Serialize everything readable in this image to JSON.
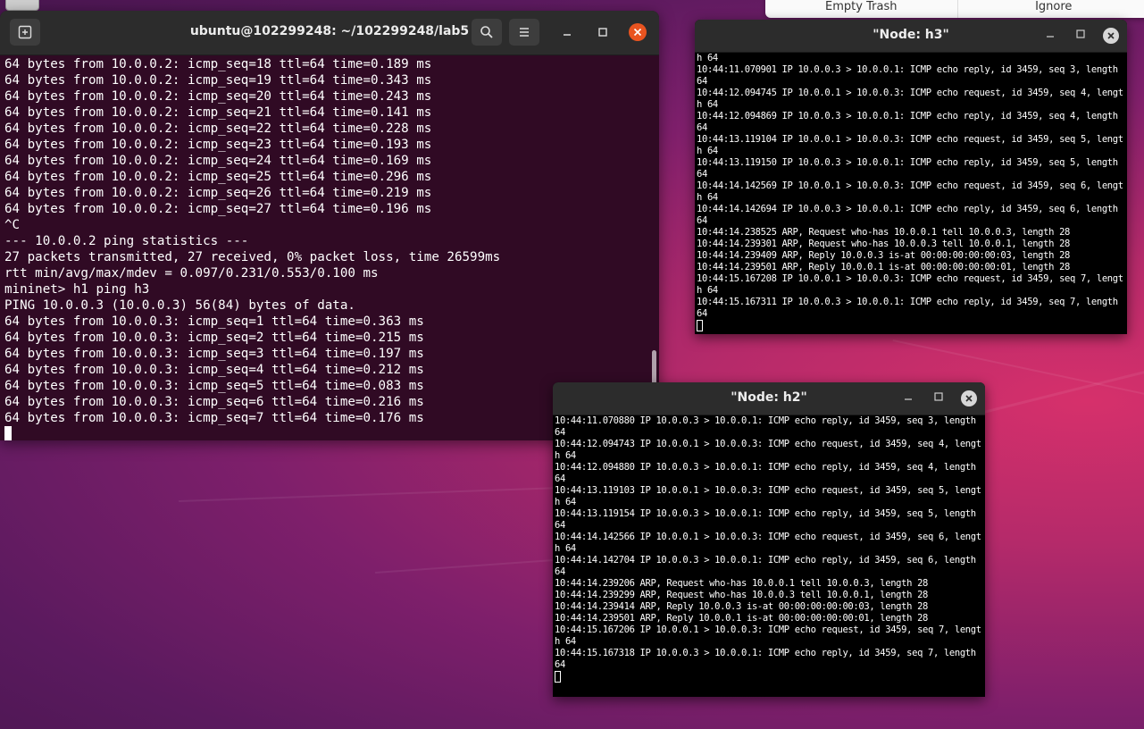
{
  "desktop": {
    "notification": {
      "left_label": "Empty Trash",
      "right_label": "Ignore"
    }
  },
  "main_terminal": {
    "title": "ubuntu@102299248: ~/102299248/lab5",
    "lines": [
      "64 bytes from 10.0.0.2: icmp_seq=18 ttl=64 time=0.189 ms",
      "64 bytes from 10.0.0.2: icmp_seq=19 ttl=64 time=0.343 ms",
      "64 bytes from 10.0.0.2: icmp_seq=20 ttl=64 time=0.243 ms",
      "64 bytes from 10.0.0.2: icmp_seq=21 ttl=64 time=0.141 ms",
      "64 bytes from 10.0.0.2: icmp_seq=22 ttl=64 time=0.228 ms",
      "64 bytes from 10.0.0.2: icmp_seq=23 ttl=64 time=0.193 ms",
      "64 bytes from 10.0.0.2: icmp_seq=24 ttl=64 time=0.169 ms",
      "64 bytes from 10.0.0.2: icmp_seq=25 ttl=64 time=0.296 ms",
      "64 bytes from 10.0.0.2: icmp_seq=26 ttl=64 time=0.219 ms",
      "64 bytes from 10.0.0.2: icmp_seq=27 ttl=64 time=0.196 ms",
      "^C",
      "--- 10.0.0.2 ping statistics ---",
      "27 packets transmitted, 27 received, 0% packet loss, time 26599ms",
      "rtt min/avg/max/mdev = 0.097/0.231/0.553/0.100 ms",
      "mininet> h1 ping h3",
      "PING 10.0.0.3 (10.0.0.3) 56(84) bytes of data.",
      "64 bytes from 10.0.0.3: icmp_seq=1 ttl=64 time=0.363 ms",
      "64 bytes from 10.0.0.3: icmp_seq=2 ttl=64 time=0.215 ms",
      "64 bytes from 10.0.0.3: icmp_seq=3 ttl=64 time=0.197 ms",
      "64 bytes from 10.0.0.3: icmp_seq=4 ttl=64 time=0.212 ms",
      "64 bytes from 10.0.0.3: icmp_seq=5 ttl=64 time=0.083 ms",
      "64 bytes from 10.0.0.3: icmp_seq=6 ttl=64 time=0.216 ms",
      "64 bytes from 10.0.0.3: icmp_seq=7 ttl=64 time=0.176 ms"
    ]
  },
  "node_h3": {
    "title": "\"Node: h3\"",
    "lines": [
      "h 64",
      "10:44:11.070901 IP 10.0.0.3 > 10.0.0.1: ICMP echo reply, id 3459, seq 3, length",
      "64",
      "10:44:12.094745 IP 10.0.0.1 > 10.0.0.3: ICMP echo request, id 3459, seq 4, lengt",
      "h 64",
      "10:44:12.094869 IP 10.0.0.3 > 10.0.0.1: ICMP echo reply, id 3459, seq 4, length",
      "64",
      "10:44:13.119104 IP 10.0.0.1 > 10.0.0.3: ICMP echo request, id 3459, seq 5, lengt",
      "h 64",
      "10:44:13.119150 IP 10.0.0.3 > 10.0.0.1: ICMP echo reply, id 3459, seq 5, length",
      "64",
      "10:44:14.142569 IP 10.0.0.1 > 10.0.0.3: ICMP echo request, id 3459, seq 6, lengt",
      "h 64",
      "10:44:14.142694 IP 10.0.0.3 > 10.0.0.1: ICMP echo reply, id 3459, seq 6, length",
      "64",
      "10:44:14.238525 ARP, Request who-has 10.0.0.1 tell 10.0.0.3, length 28",
      "10:44:14.239301 ARP, Request who-has 10.0.0.3 tell 10.0.0.1, length 28",
      "10:44:14.239409 ARP, Reply 10.0.0.3 is-at 00:00:00:00:00:03, length 28",
      "10:44:14.239501 ARP, Reply 10.0.0.1 is-at 00:00:00:00:00:01, length 28",
      "10:44:15.167208 IP 10.0.0.1 > 10.0.0.3: ICMP echo request, id 3459, seq 7, lengt",
      "h 64",
      "10:44:15.167311 IP 10.0.0.3 > 10.0.0.1: ICMP echo reply, id 3459, seq 7, length",
      "64"
    ]
  },
  "node_h2": {
    "title": "\"Node: h2\"",
    "lines": [
      "10:44:11.070880 IP 10.0.0.3 > 10.0.0.1: ICMP echo reply, id 3459, seq 3, length",
      "64",
      "10:44:12.094743 IP 10.0.0.1 > 10.0.0.3: ICMP echo request, id 3459, seq 4, lengt",
      "h 64",
      "10:44:12.094880 IP 10.0.0.3 > 10.0.0.1: ICMP echo reply, id 3459, seq 4, length",
      "64",
      "10:44:13.119103 IP 10.0.0.1 > 10.0.0.3: ICMP echo request, id 3459, seq 5, lengt",
      "h 64",
      "10:44:13.119154 IP 10.0.0.3 > 10.0.0.1: ICMP echo reply, id 3459, seq 5, length",
      "64",
      "10:44:14.142566 IP 10.0.0.1 > 10.0.0.3: ICMP echo request, id 3459, seq 6, lengt",
      "h 64",
      "10:44:14.142704 IP 10.0.0.3 > 10.0.0.1: ICMP echo reply, id 3459, seq 6, length",
      "64",
      "10:44:14.239206 ARP, Request who-has 10.0.0.1 tell 10.0.0.3, length 28",
      "10:44:14.239299 ARP, Request who-has 10.0.0.3 tell 10.0.0.1, length 28",
      "10:44:14.239414 ARP, Reply 10.0.0.3 is-at 00:00:00:00:00:03, length 28",
      "10:44:14.239501 ARP, Reply 10.0.0.1 is-at 00:00:00:00:00:01, length 28",
      "10:44:15.167206 IP 10.0.0.1 > 10.0.0.3: ICMP echo request, id 3459, seq 7, lengt",
      "h 64",
      "10:44:15.167318 IP 10.0.0.3 > 10.0.0.1: ICMP echo reply, id 3459, seq 7, length",
      "64"
    ]
  }
}
